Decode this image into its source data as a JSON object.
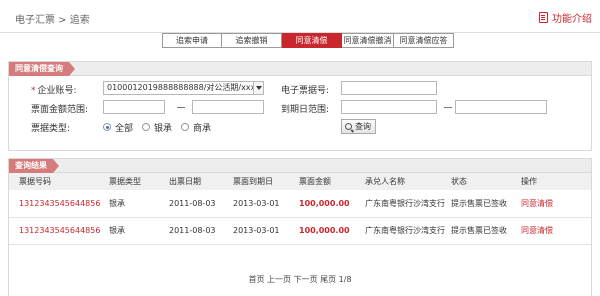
{
  "header": {
    "breadcrumb": "电子汇票 > 追索",
    "help_label": "功能介绍",
    "help_icon": "book-icon"
  },
  "tabs": [
    {
      "label": "追索申请",
      "active": false
    },
    {
      "label": "追索撤销",
      "active": false
    },
    {
      "label": "同意清偿",
      "active": true
    },
    {
      "label": "同意清偿撤消",
      "active": false
    },
    {
      "label": "同意清偿应答",
      "active": false
    }
  ],
  "query": {
    "title": "同意清偿查询",
    "account_label": "企业账号:",
    "account_value": "0100012019888888888/对公活期/xxx公",
    "bill_no_label": "电子票据号:",
    "bill_no_value": "",
    "amount_range_label": "票面金额范围:",
    "amount_from": "",
    "amount_to": "",
    "due_date_label": "到期日范围:",
    "due_from": "",
    "due_to": "",
    "bill_type_label": "票据类型:",
    "bill_type_options": [
      {
        "label": "全部",
        "selected": true
      },
      {
        "label": "银承",
        "selected": false
      },
      {
        "label": "商承",
        "selected": false
      }
    ],
    "search_label": "查询",
    "search_icon": "search-icon",
    "accent_color": "#c8282d",
    "tag_color": "#d67b7b"
  },
  "results": {
    "title": "查询结果",
    "columns": [
      "票据号码",
      "票据类型",
      "出票日期",
      "票面到期日",
      "票面金额",
      "承兑人名称",
      "状态",
      "操作"
    ],
    "rows": [
      {
        "bill_no": "1312343545644856",
        "type": "银承",
        "issue_date": "2011-08-03",
        "due_date": "2013-03-01",
        "amount": "100,000.00",
        "acceptor": "广东南粤银行沙湾支行",
        "status": "提示售票已签收",
        "action": "同意清偿"
      },
      {
        "bill_no": "1312343545644856",
        "type": "银承",
        "issue_date": "2011-08-03",
        "due_date": "2013-03-01",
        "amount": "100,000.00",
        "acceptor": "广东南粤银行沙湾支行",
        "status": "提示售票已签收",
        "action": "同意清偿"
      }
    ],
    "pager": {
      "first": "首页",
      "prev": "上一页",
      "next": "下一页",
      "last": "尾页",
      "page": "1/8"
    }
  }
}
